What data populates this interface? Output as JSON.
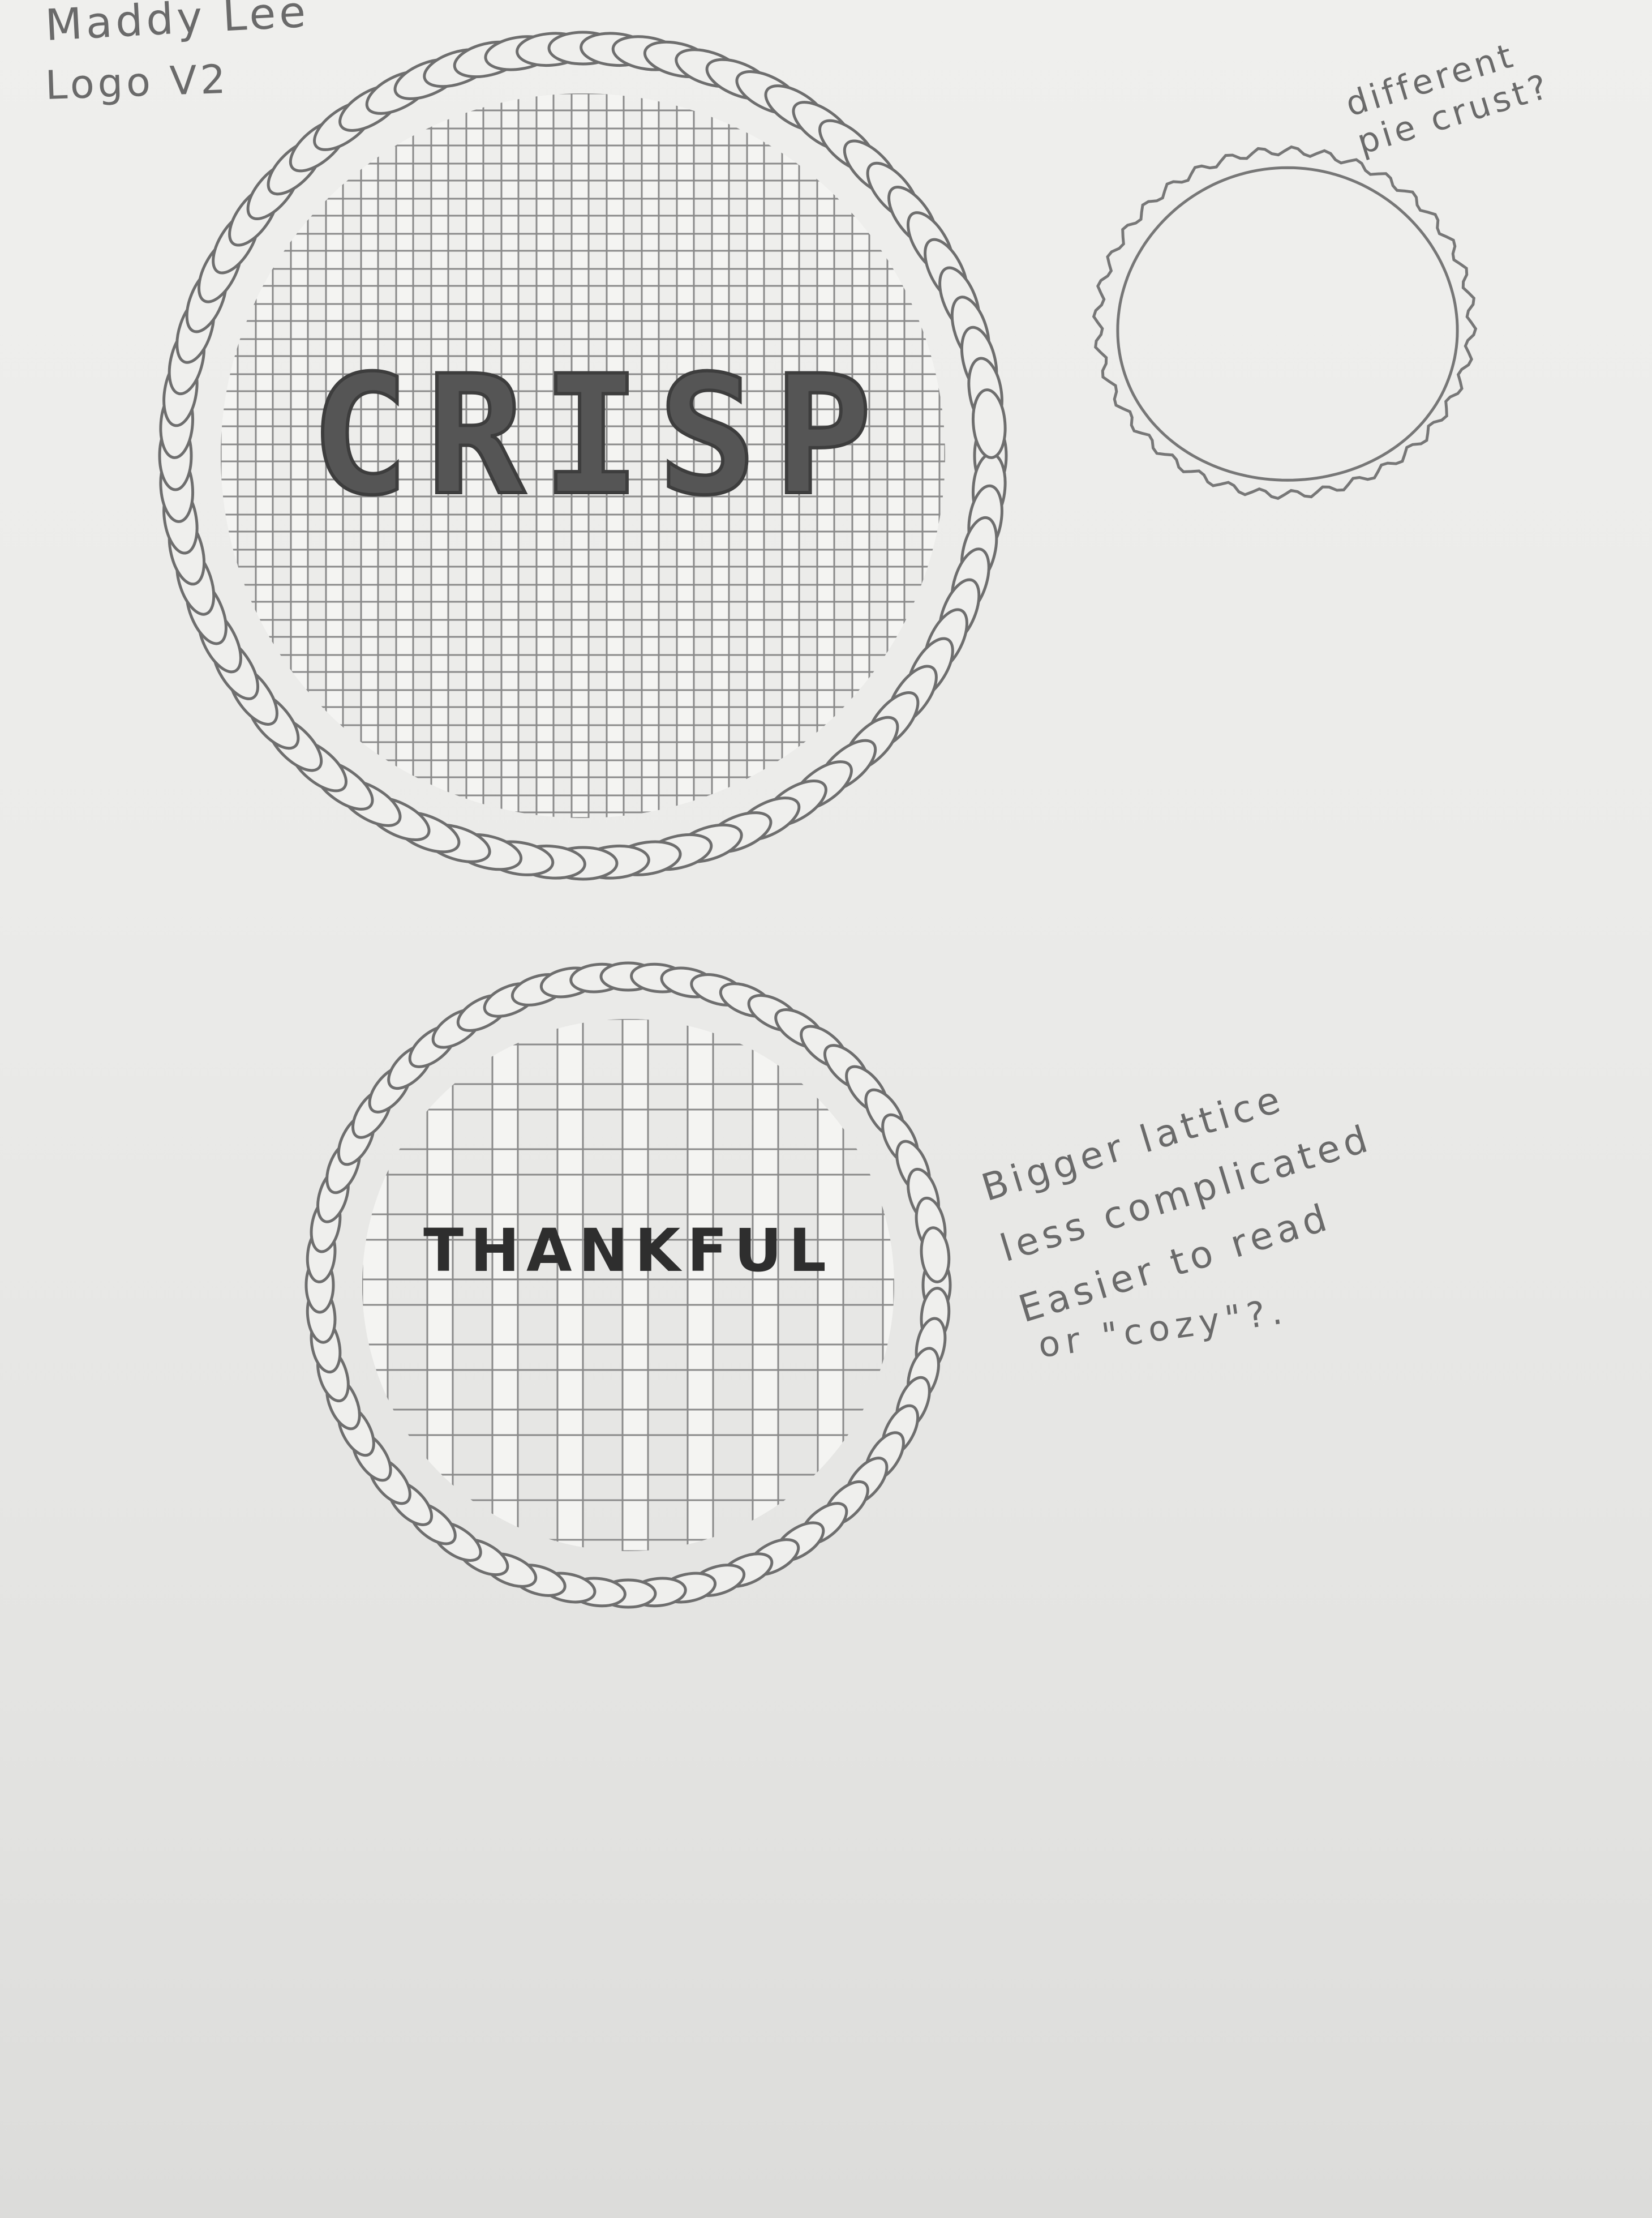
{
  "sketch": {
    "author_name": "Maddy Lee",
    "logo_version": "Logo V2",
    "notes": {
      "top_right": "different\npie crust?",
      "bottom_right": "Bigger lattice\nless complicated\nEasier to read",
      "alternative": "or \"cozy\"?."
    }
  },
  "pies": {
    "large": {
      "label": "CRISP"
    },
    "small": {
      "label": "THANKFUL"
    }
  },
  "colors": {
    "pencil": "#6a6a6a",
    "paper": "#ececea",
    "lettering": "#555555"
  }
}
